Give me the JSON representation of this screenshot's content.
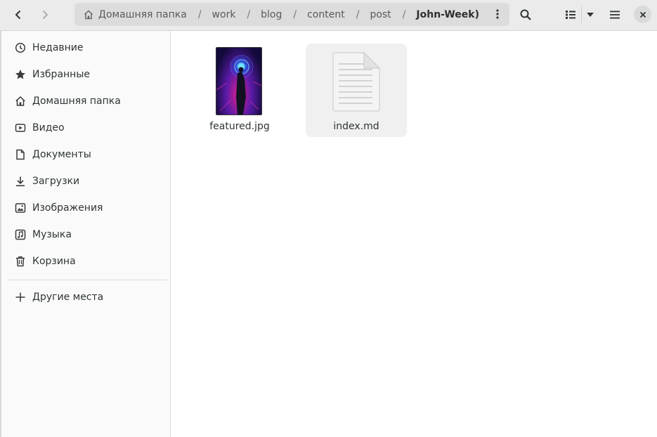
{
  "headerbar": {
    "back_icon": "chevron-left-icon",
    "forward_icon": "chevron-right-icon",
    "breadcrumb": [
      {
        "label": "Домашняя папка",
        "icon": "home-icon"
      },
      {
        "label": "work"
      },
      {
        "label": "blog"
      },
      {
        "label": "content"
      },
      {
        "label": "post"
      },
      {
        "label": "John-Week)"
      }
    ],
    "separator": "/",
    "path_menu_icon": "vertical-dots-icon",
    "search_icon": "search-icon",
    "view_icon": "list-view-icon",
    "view_dropdown_icon": "dropdown-arrow-icon",
    "menu_icon": "hamburger-icon",
    "close_icon": "close-icon"
  },
  "sidebar": {
    "items": [
      {
        "label": "Недавние",
        "icon": "clock-icon"
      },
      {
        "label": "Избранные",
        "icon": "star-icon"
      },
      {
        "label": "Домашняя папка",
        "icon": "home-icon"
      },
      {
        "label": "Видео",
        "icon": "video-icon"
      },
      {
        "label": "Документы",
        "icon": "document-icon"
      },
      {
        "label": "Загрузки",
        "icon": "download-icon"
      },
      {
        "label": "Изображения",
        "icon": "image-icon"
      },
      {
        "label": "Музыка",
        "icon": "music-icon"
      },
      {
        "label": "Корзина",
        "icon": "trash-icon"
      }
    ],
    "other_places": {
      "label": "Другие места",
      "icon": "plus-icon"
    }
  },
  "files": [
    {
      "name": "featured.jpg",
      "type": "image"
    },
    {
      "name": "index.md",
      "type": "text"
    }
  ]
}
